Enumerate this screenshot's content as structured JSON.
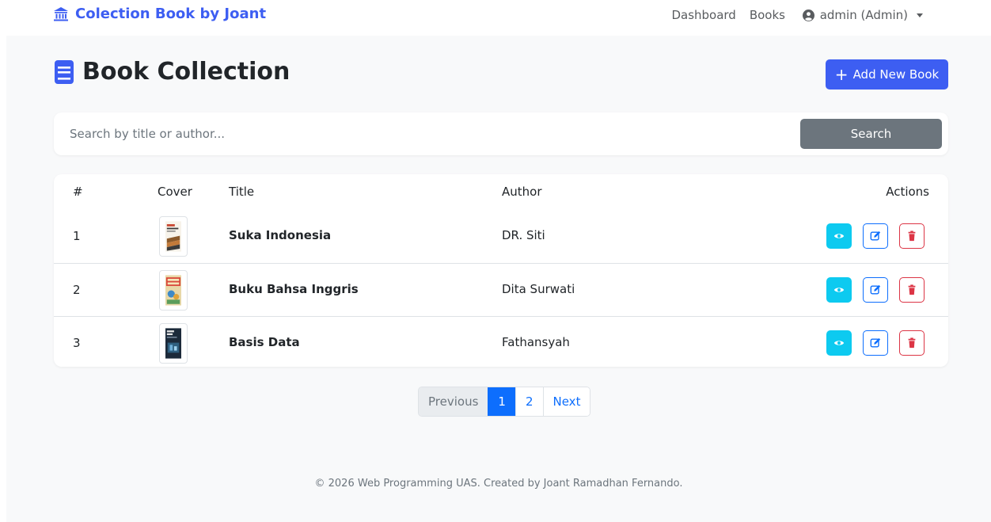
{
  "navbar": {
    "brand": "Colection Book by Joant",
    "links": [
      "Dashboard",
      "Books"
    ],
    "user": "admin (Admin)"
  },
  "page": {
    "title": "Book Collection",
    "add_button": "Add New Book"
  },
  "search": {
    "placeholder": "Search by title or author...",
    "button": "Search"
  },
  "table": {
    "headers": [
      "#",
      "Cover",
      "Title",
      "Author",
      "Actions"
    ],
    "rows": [
      {
        "num": "1",
        "title": "Suka Indonesia",
        "author": "DR. Siti"
      },
      {
        "num": "2",
        "title": "Buku Bahsa Inggris",
        "author": "Dita Surwati"
      },
      {
        "num": "3",
        "title": "Basis Data",
        "author": "Fathansyah"
      }
    ]
  },
  "pagination": {
    "previous": "Previous",
    "pages": [
      "1",
      "2"
    ],
    "next": "Next",
    "current": "1"
  },
  "footer": "© 2026 Web Programming UAS. Created by Joant Ramadhan Fernando.",
  "colors": {
    "primary": "#3d5ef2",
    "info": "#0dcaf0",
    "danger": "#dc3545",
    "secondary": "#6c757d"
  }
}
